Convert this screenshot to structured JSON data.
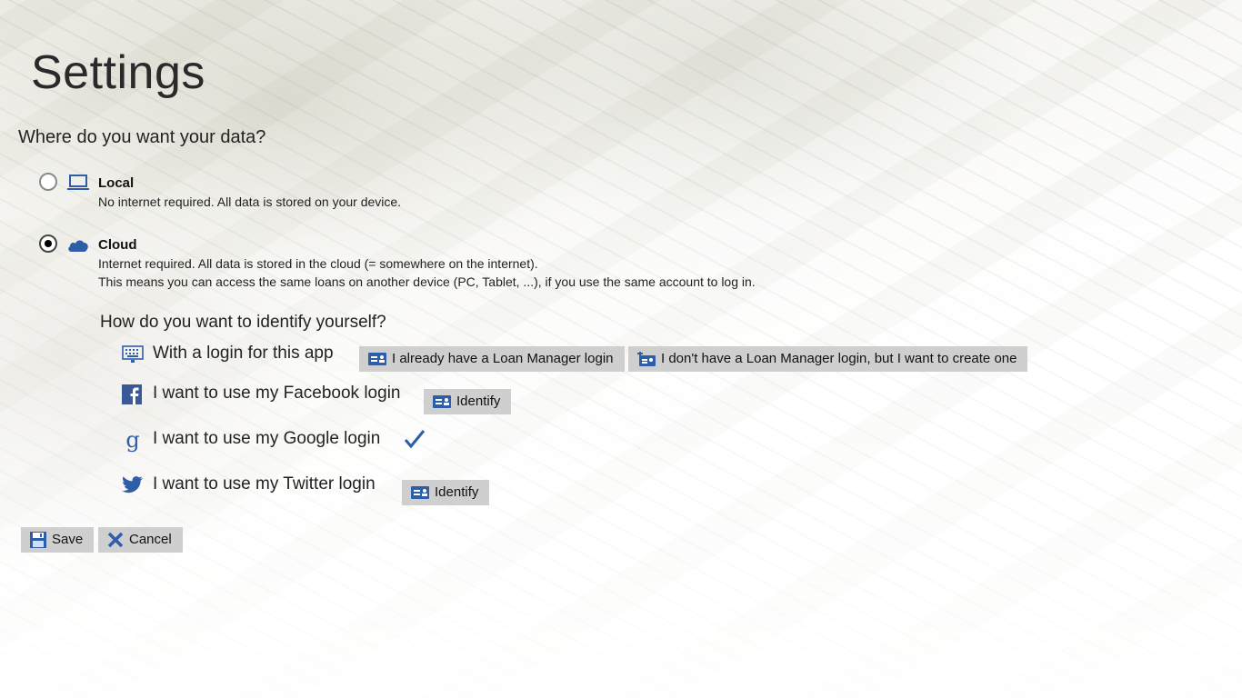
{
  "page": {
    "title": "Settings"
  },
  "storage": {
    "question": "Where do you want your data?",
    "options": [
      {
        "title": "Local",
        "description": "No internet required. All data is stored on your device.",
        "icon": "laptop-icon",
        "selected": false
      },
      {
        "title": "Cloud",
        "description_line1": "Internet required. All data is stored in the cloud (= somewhere on the internet).",
        "description_line2": "This means you can access the same loans on another device (PC, Tablet, ...), if you use the same account to log in.",
        "icon": "cloud-icon",
        "selected": true
      }
    ]
  },
  "identity": {
    "question": "How do you want to identify yourself?",
    "app_login": {
      "label": "With a login for this app",
      "existing_button": "I already have a Loan Manager login",
      "create_button": "I don't have a Loan Manager login, but I want to create one"
    },
    "facebook": {
      "label": "I want to use my Facebook login",
      "button": "Identify"
    },
    "google": {
      "label": "I want to use my Google login",
      "identified": true
    },
    "twitter": {
      "label": "I want to use my Twitter login",
      "button": "Identify"
    }
  },
  "footer": {
    "save": "Save",
    "cancel": "Cancel"
  },
  "colors": {
    "accent": "#2f5ea8",
    "button_bg": "#cfcfcf",
    "facebook": "#3b5998"
  }
}
